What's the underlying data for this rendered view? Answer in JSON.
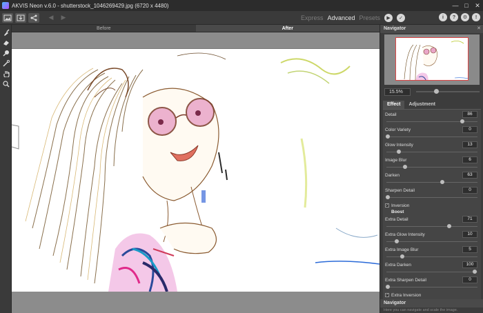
{
  "window": {
    "title": "AKVIS Neon v.6.0 - shutterstock_1046269429.jpg (6720 x 4480)",
    "controls": [
      "—",
      "□",
      "✕"
    ]
  },
  "toolbar": {
    "modes": [
      {
        "label": "Express",
        "active": false
      },
      {
        "label": "Advanced",
        "active": true
      },
      {
        "label": "Presets",
        "active": false
      }
    ],
    "run_icon": "▶",
    "apply_icon": "✓",
    "right_icons": [
      "i",
      "?",
      "⚙",
      "!"
    ]
  },
  "tools": [
    "brush-icon",
    "eraser-icon",
    "smudge-icon",
    "wand-icon",
    "hand-icon",
    "zoom-icon"
  ],
  "view_tabs": [
    {
      "label": "Before",
      "active": false
    },
    {
      "label": "After",
      "active": true
    }
  ],
  "navigator": {
    "title": "Navigator",
    "zoom": "15.5%",
    "zoom_level": 0.3
  },
  "effect_tabs": [
    {
      "label": "Effect",
      "active": true
    },
    {
      "label": "Adjustment",
      "active": false
    }
  ],
  "params": [
    {
      "label": "Detail",
      "value": "86",
      "frac": 0.86
    },
    {
      "label": "Color Variety",
      "value": "0",
      "frac": 0.0
    },
    {
      "label": "Glow Intensity",
      "value": "13",
      "frac": 0.13
    },
    {
      "label": "Image Blur",
      "value": "6",
      "frac": 0.2
    },
    {
      "label": "Darken",
      "value": "63",
      "frac": 0.63
    },
    {
      "label": "Sharpen Detail",
      "value": "0",
      "frac": 0.0
    }
  ],
  "inversion": {
    "label": "Inversion",
    "checked": true
  },
  "boost": {
    "title": "Boost",
    "params": [
      {
        "label": "Extra Detail",
        "value": "71",
        "frac": 0.71
      },
      {
        "label": "Extra Glow Intensity",
        "value": "10",
        "frac": 0.1
      },
      {
        "label": "Extra Image Blur",
        "value": "5",
        "frac": 0.17
      },
      {
        "label": "Extra Darken",
        "value": "100",
        "frac": 1.0
      },
      {
        "label": "Extra Sharpen Detail",
        "value": "0",
        "frac": 0.0
      }
    ],
    "inversion": {
      "label": "Extra Inversion",
      "checked": true
    }
  },
  "help": {
    "title": "Navigator",
    "text": "Here you can navigate and scale the image."
  }
}
